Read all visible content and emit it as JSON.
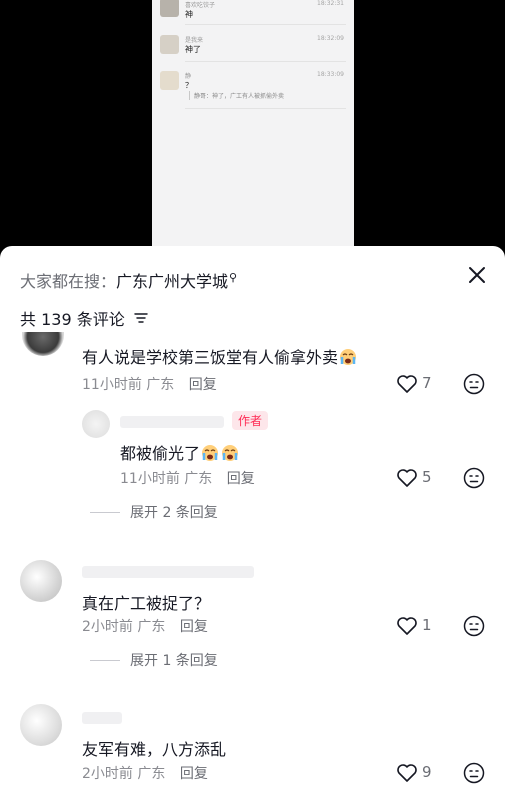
{
  "chat": {
    "messages": [
      {
        "name": "喜欢吃饺子",
        "time": "18:32:31",
        "text": "神"
      },
      {
        "name": "是我来",
        "time": "18:32:09",
        "text": "神了"
      },
      {
        "name": "静",
        "time": "18:33:09",
        "text": "？",
        "quote": "静哥：神了，广工有人被抓偷外卖"
      }
    ]
  },
  "header": {
    "search_prefix": "大家都在搜：",
    "search_keyword": "广东广州大学城",
    "comment_count": "共 139 条评论"
  },
  "comments": [
    {
      "text": "有人说是学校第三饭堂有人偷拿外卖",
      "time": "11小时前",
      "location": "广东",
      "reply_label": "回复",
      "likes": "7",
      "emoji": "crying-face"
    },
    {
      "text": "都被偷光了",
      "time": "11小时前",
      "location": "广东",
      "reply_label": "回复",
      "likes": "5",
      "badge": "作者",
      "emoji": "crying-face"
    },
    {
      "text": "真在广工被捉了？",
      "time": "2小时前",
      "location": "广东",
      "reply_label": "回复",
      "likes": "1"
    },
    {
      "text": "友军有难，八方添乱",
      "time": "2小时前",
      "location": "广东",
      "reply_label": "回复",
      "likes": "9"
    }
  ],
  "expand": [
    "展开 2 条回复",
    "展开 1 条回复"
  ],
  "colors": {
    "accent": "#fe2c55",
    "text_primary": "#161823",
    "text_secondary": "#8a8b91"
  }
}
